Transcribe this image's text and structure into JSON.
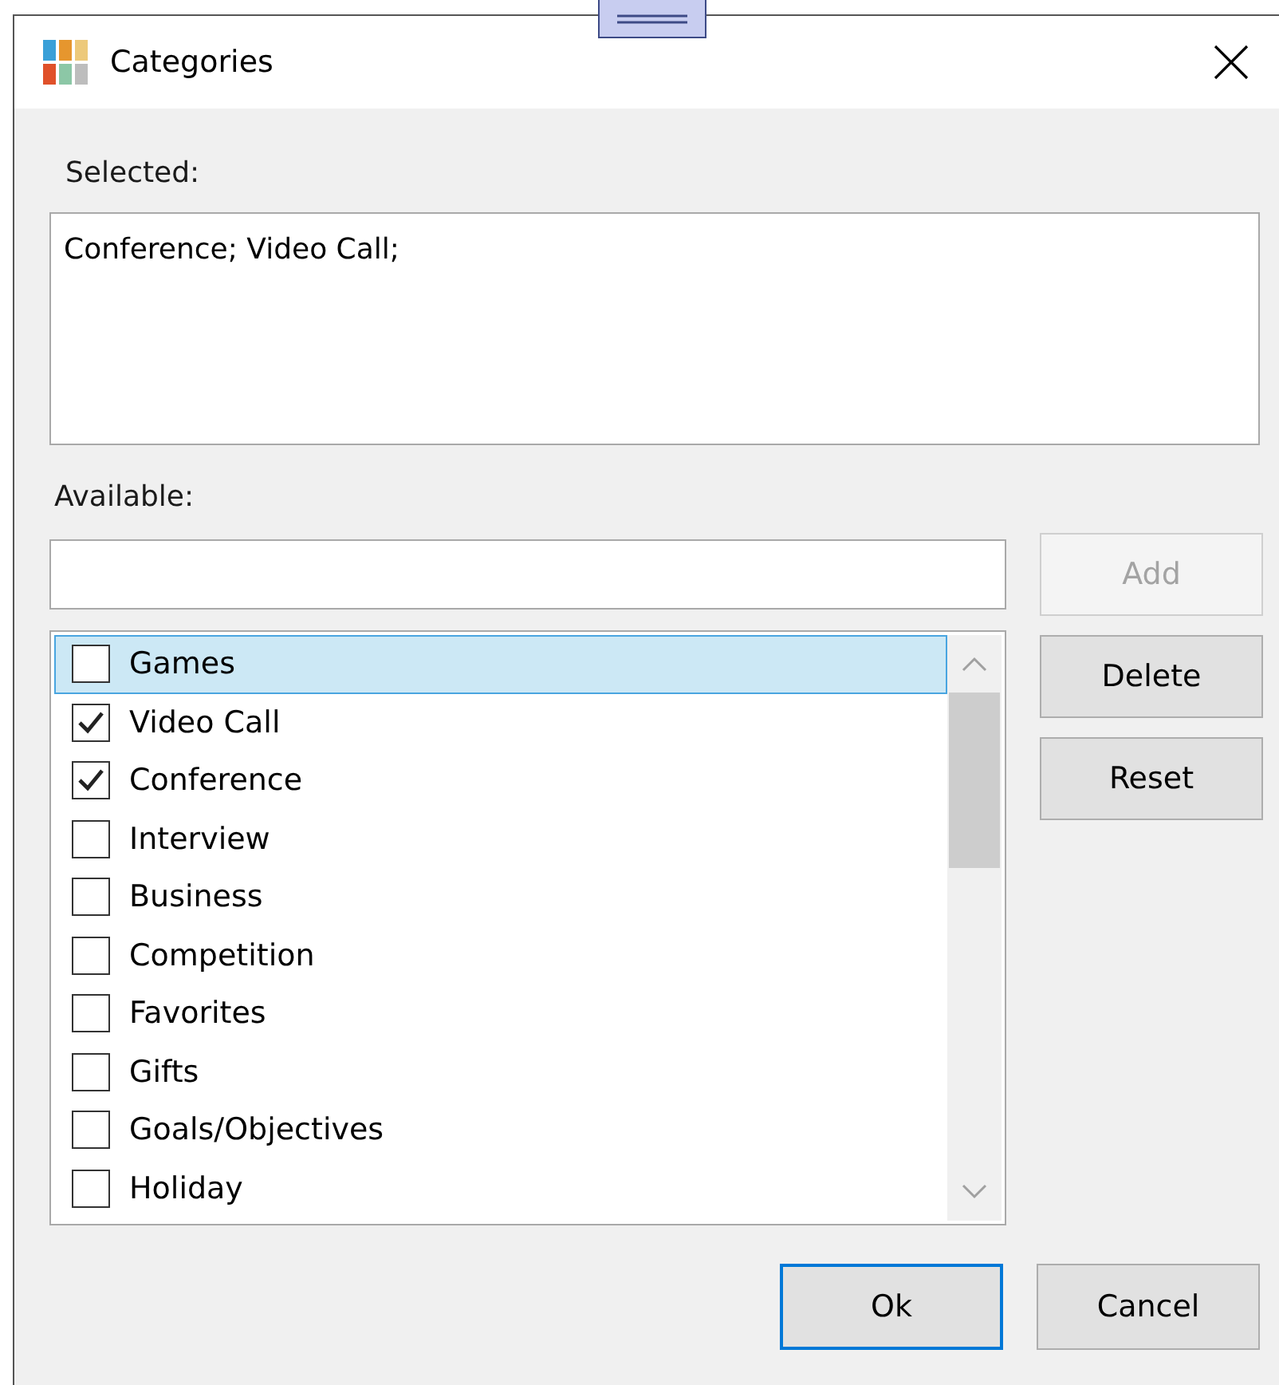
{
  "window": {
    "title": "Categories"
  },
  "selected_label": "Selected:",
  "selected_field": {
    "value": "Conference; Video Call;"
  },
  "available_label": "Available:",
  "side_buttons": [
    {
      "label": "Add",
      "disabled": true
    },
    {
      "label": "Delete",
      "disabled": false
    },
    {
      "label": "Reset",
      "disabled": false
    }
  ],
  "categories": [
    {
      "label": "Games",
      "checked": false,
      "selected": true
    },
    {
      "label": "Video Call",
      "checked": true,
      "selected": false
    },
    {
      "label": "Conference",
      "checked": true,
      "selected": false
    },
    {
      "label": "Interview",
      "checked": false,
      "selected": false
    },
    {
      "label": "Business",
      "checked": false,
      "selected": false
    },
    {
      "label": "Competition",
      "checked": false,
      "selected": false
    },
    {
      "label": "Favorites",
      "checked": false,
      "selected": false
    },
    {
      "label": "Gifts",
      "checked": false,
      "selected": false
    },
    {
      "label": "Goals/Objectives",
      "checked": false,
      "selected": false
    },
    {
      "label": "Holiday",
      "checked": false,
      "selected": false
    }
  ],
  "buttons": [
    {
      "label": "Ok",
      "default": true
    },
    {
      "label": "Cancel",
      "default": false
    }
  ]
}
